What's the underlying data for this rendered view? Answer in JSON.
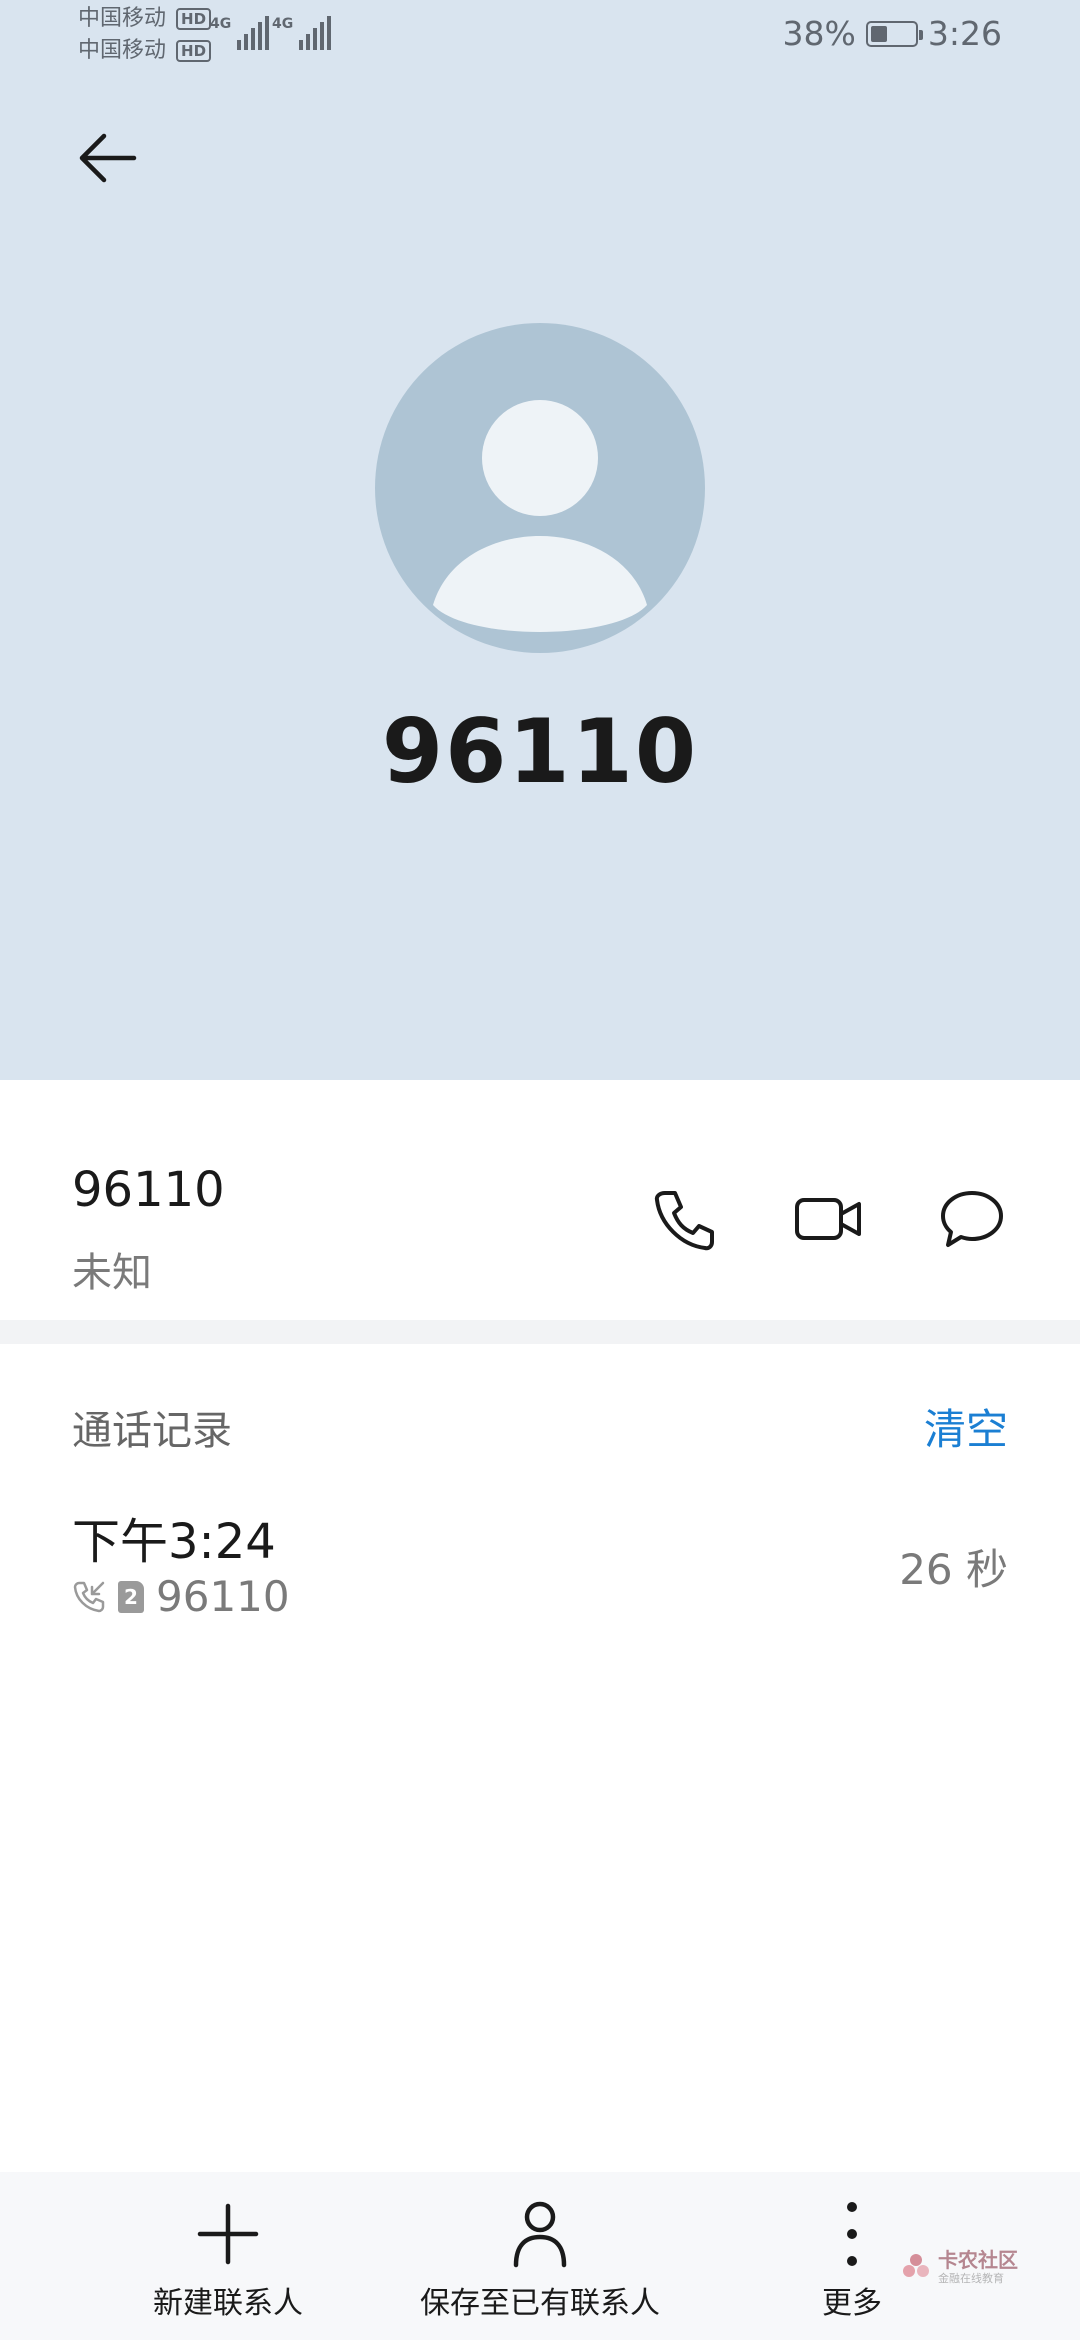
{
  "status_bar": {
    "carrier_1": "中国移动",
    "carrier_2": "中国移动",
    "hd_label": "HD",
    "network_1": "4G",
    "network_2": "4G",
    "battery_percent": "38%",
    "battery_level": 0.38,
    "time": "3:26"
  },
  "header": {
    "title": "96110"
  },
  "number_row": {
    "number": "96110",
    "type": "未知"
  },
  "call_log": {
    "header": "通话记录",
    "clear_label": "清空",
    "entries": [
      {
        "time": "下午3:24",
        "sim": "2",
        "number": "96110",
        "duration": "26 秒"
      }
    ]
  },
  "toolbar": {
    "new_contact_label": "新建联系人",
    "save_existing_label": "保存至已有联系人",
    "more_label": "更多"
  },
  "watermark": {
    "main": "卡农社区",
    "sub": "金融在线教育"
  },
  "colors": {
    "header_bg": "#d9e4ef",
    "avatar_bg": "#aec4d4",
    "accent": "#1b7fd3"
  }
}
